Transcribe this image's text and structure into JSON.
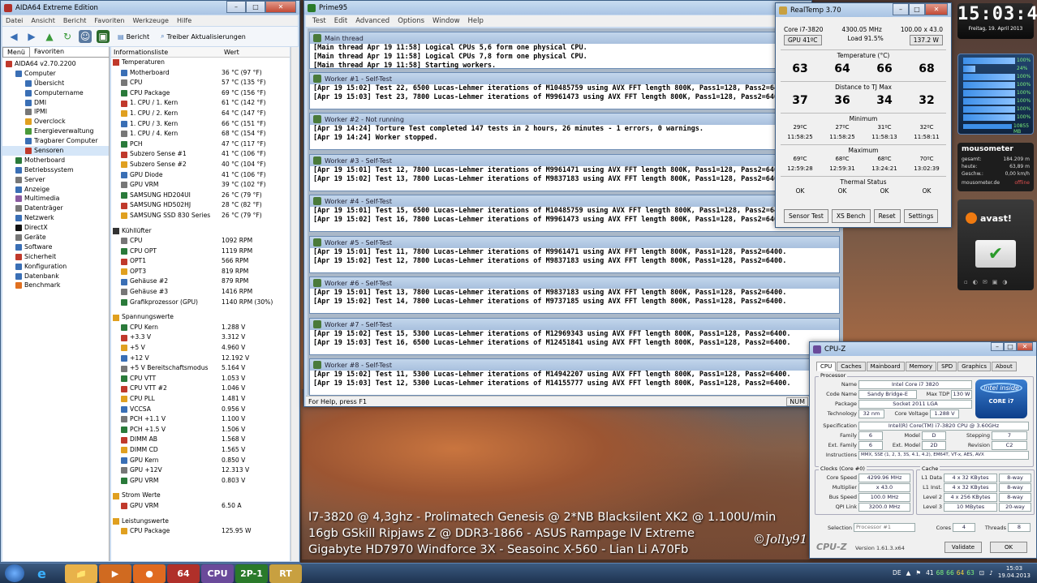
{
  "aida": {
    "title": "AIDA64 Extreme Edition",
    "menu": [
      "Datei",
      "Ansicht",
      "Bericht",
      "Favoriten",
      "Werkzeuge",
      "Hilfe"
    ],
    "toolbar": {
      "report": "Bericht",
      "driver_update": "Treiber Aktualisierungen"
    },
    "tabs": [
      "Menü",
      "Favoriten"
    ],
    "tree": [
      {
        "label": "AIDA64 v2.70.2200",
        "indent": 0,
        "color": "#c0392b"
      },
      {
        "label": "Computer",
        "indent": 1,
        "color": "#3a6fb5"
      },
      {
        "label": "Übersicht",
        "indent": 2,
        "color": "#3a6fb5"
      },
      {
        "label": "Computername",
        "indent": 2,
        "color": "#3a6fb5"
      },
      {
        "label": "DMI",
        "indent": 2,
        "color": "#3a6fb5"
      },
      {
        "label": "IPMI",
        "indent": 2,
        "color": "#777"
      },
      {
        "label": "Overclock",
        "indent": 2,
        "color": "#e0a020"
      },
      {
        "label": "Energieverwaltung",
        "indent": 2,
        "color": "#4a9a3a"
      },
      {
        "label": "Tragbarer Computer",
        "indent": 2,
        "color": "#3a6fb5"
      },
      {
        "label": "Sensoren",
        "indent": 2,
        "color": "#c0392b"
      },
      {
        "label": "Motherboard",
        "indent": 1,
        "color": "#2a7a3a"
      },
      {
        "label": "Betriebssystem",
        "indent": 1,
        "color": "#3a6fb5"
      },
      {
        "label": "Server",
        "indent": 1,
        "color": "#777"
      },
      {
        "label": "Anzeige",
        "indent": 1,
        "color": "#3a6fb5"
      },
      {
        "label": "Multimedia",
        "indent": 1,
        "color": "#8a5aa0"
      },
      {
        "label": "Datenträger",
        "indent": 1,
        "color": "#777"
      },
      {
        "label": "Netzwerk",
        "indent": 1,
        "color": "#3a6fb5"
      },
      {
        "label": "DirectX",
        "indent": 1,
        "color": "#111"
      },
      {
        "label": "Geräte",
        "indent": 1,
        "color": "#777"
      },
      {
        "label": "Software",
        "indent": 1,
        "color": "#3a6fb5"
      },
      {
        "label": "Sicherheit",
        "indent": 1,
        "color": "#c0392b"
      },
      {
        "label": "Konfiguration",
        "indent": 1,
        "color": "#3a6fb5"
      },
      {
        "label": "Datenbank",
        "indent": 1,
        "color": "#3a6fb5"
      },
      {
        "label": "Benchmark",
        "indent": 1,
        "color": "#e07020"
      }
    ],
    "columns": [
      "Informationsliste",
      "Wert"
    ],
    "groups": [
      {
        "title": "Temperaturen",
        "icon": "thermometer-icon",
        "rows": [
          [
            "Motherboard",
            "36 °C  (97 °F)"
          ],
          [
            "CPU",
            "57 °C  (135 °F)"
          ],
          [
            "CPU Package",
            "69 °C  (156 °F)"
          ],
          [
            "1. CPU / 1. Kern",
            "61 °C  (142 °F)"
          ],
          [
            "1. CPU / 2. Kern",
            "64 °C  (147 °F)"
          ],
          [
            "1. CPU / 3. Kern",
            "66 °C  (151 °F)"
          ],
          [
            "1. CPU / 4. Kern",
            "68 °C  (154 °F)"
          ],
          [
            "PCH",
            "47 °C  (117 °F)"
          ],
          [
            "Subzero Sense #1",
            "41 °C  (106 °F)"
          ],
          [
            "Subzero Sense #2",
            "40 °C  (104 °F)"
          ],
          [
            "GPU Diode",
            "41 °C  (106 °F)"
          ],
          [
            "GPU VRM",
            "39 °C  (102 °F)"
          ],
          [
            "SAMSUNG HD204UI",
            "26 °C  (79 °F)"
          ],
          [
            "SAMSUNG HD502HJ",
            "28 °C  (82 °F)"
          ],
          [
            "SAMSUNG SSD 830 Series",
            "26 °C  (79 °F)"
          ]
        ]
      },
      {
        "title": "Kühllüfter",
        "icon": "fan-icon",
        "rows": [
          [
            "CPU",
            "1092 RPM"
          ],
          [
            "CPU OPT",
            "1119 RPM"
          ],
          [
            "OPT1",
            "566 RPM"
          ],
          [
            "OPT3",
            "819 RPM"
          ],
          [
            "Gehäuse #2",
            "879 RPM"
          ],
          [
            "Gehäuse #3",
            "1416 RPM"
          ],
          [
            "Grafikprozessor (GPU)",
            "1140 RPM  (30%)"
          ]
        ]
      },
      {
        "title": "Spannungswerte",
        "icon": "warning-icon",
        "rows": [
          [
            "CPU Kern",
            "1.288 V"
          ],
          [
            "+3.3 V",
            "3.312 V"
          ],
          [
            "+5 V",
            "4.960 V"
          ],
          [
            "+12 V",
            "12.192 V"
          ],
          [
            "+5 V Bereitschaftsmodus",
            "5.164 V"
          ],
          [
            "CPU VTT",
            "1.053 V"
          ],
          [
            "CPU VTT #2",
            "1.046 V"
          ],
          [
            "CPU PLL",
            "1.481 V"
          ],
          [
            "VCCSA",
            "0.956 V"
          ],
          [
            "PCH +1.1 V",
            "1.100 V"
          ],
          [
            "PCH +1.5 V",
            "1.506 V"
          ],
          [
            "DIMM AB",
            "1.568 V"
          ],
          [
            "DIMM CD",
            "1.565 V"
          ],
          [
            "GPU Kern",
            "0.850 V"
          ],
          [
            "GPU +12V",
            "12.313 V"
          ],
          [
            "GPU VRM",
            "0.803 V"
          ]
        ]
      },
      {
        "title": "Strom Werte",
        "icon": "warning-icon",
        "rows": [
          [
            "GPU VRM",
            "6.50 A"
          ]
        ]
      },
      {
        "title": "Leistungswerte",
        "icon": "warning-icon",
        "rows": [
          [
            "CPU Package",
            "125.95 W"
          ]
        ]
      }
    ]
  },
  "prime": {
    "title": "Prime95",
    "menu": [
      "Test",
      "Edit",
      "Advanced",
      "Options",
      "Window",
      "Help"
    ],
    "status_left": "For Help, press F1",
    "status_right": "NUM",
    "windows": [
      {
        "title": "Main thread",
        "lines": [
          "[Main thread Apr 19 11:58] Logical CPUs 5,6 form one physical CPU.",
          "[Main thread Apr 19 11:58] Logical CPUs 7,8 form one physical CPU.",
          "[Main thread Apr 19 11:58] Starting workers."
        ]
      },
      {
        "title": "Worker #1 - Self-Test",
        "lines": [
          "[Apr 19 15:02] Test 22, 6500 Lucas-Lehmer iterations of M10485759 using AVX FFT length 800K, Pass1=128, Pass2=6400.",
          "[Apr 19 15:03] Test 23, 7800 Lucas-Lehmer iterations of M9961473 using AVX FFT length 800K, Pass1=128, Pass2=6400."
        ]
      },
      {
        "title": "Worker #2 - Not running",
        "lines": [
          "[Apr 19 14:24] Torture Test completed 147 tests in 2 hours, 26 minutes - 1 errors, 0 warnings.",
          "[Apr 19 14:24] Worker stopped."
        ]
      },
      {
        "title": "Worker #3 - Self-Test",
        "lines": [
          "[Apr 19 15:01] Test 12, 7800 Lucas-Lehmer iterations of M9961471 using AVX FFT length 800K, Pass1=128, Pass2=6400.",
          "[Apr 19 15:02] Test 13, 7800 Lucas-Lehmer iterations of M9837183 using AVX FFT length 800K, Pass1=128, Pass2=6400."
        ]
      },
      {
        "title": "Worker #4 - Self-Test",
        "lines": [
          "[Apr 19 15:01] Test 15, 6500 Lucas-Lehmer iterations of M10485759 using AVX FFT length 800K, Pass1=128, Pass2=6400.",
          "[Apr 19 15:02] Test 16, 7800 Lucas-Lehmer iterations of M9961473 using AVX FFT length 800K, Pass1=128, Pass2=6400."
        ]
      },
      {
        "title": "Worker #5 - Self-Test",
        "lines": [
          "[Apr 19 15:01] Test 11, 7800 Lucas-Lehmer iterations of M9961471 using AVX FFT length 800K, Pass1=128, Pass2=6400.",
          "[Apr 19 15:02] Test 12, 7800 Lucas-Lehmer iterations of M9837183 using AVX FFT length 800K, Pass1=128, Pass2=6400."
        ]
      },
      {
        "title": "Worker #6 - Self-Test",
        "lines": [
          "[Apr 19 15:01] Test 13, 7800 Lucas-Lehmer iterations of M9837183 using AVX FFT length 800K, Pass1=128, Pass2=6400.",
          "[Apr 19 15:02] Test 14, 7800 Lucas-Lehmer iterations of M9737185 using AVX FFT length 800K, Pass1=128, Pass2=6400."
        ]
      },
      {
        "title": "Worker #7 - Self-Test",
        "lines": [
          "[Apr 19 15:02] Test 15, 5300 Lucas-Lehmer iterations of M12969343 using AVX FFT length 800K, Pass1=128, Pass2=6400.",
          "[Apr 19 15:03] Test 16, 6500 Lucas-Lehmer iterations of M12451841 using AVX FFT length 800K, Pass1=128, Pass2=6400."
        ]
      },
      {
        "title": "Worker #8 - Self-Test",
        "lines": [
          "[Apr 19 15:02] Test 11, 5300 Lucas-Lehmer iterations of M14942207 using AVX FFT length 800K, Pass1=128, Pass2=6400.",
          "[Apr 19 15:03] Test 12, 5300 Lucas-Lehmer iterations of M14155777 using AVX FFT length 800K, Pass1=128, Pass2=6400."
        ]
      }
    ]
  },
  "realtemp": {
    "title": "RealTemp 3.70",
    "cpu": "Core i7-3820",
    "mhz": "4300.05 MHz",
    "multi": "100.00 x 43.0",
    "gpu_btn": "GPU  41ºC",
    "load": "Load  91.5%",
    "watts": "137.2 W",
    "temp_label": "Temperature (°C)",
    "temps": [
      "63",
      "64",
      "66",
      "68"
    ],
    "dist_label": "Distance to TJ Max",
    "dist": [
      "37",
      "36",
      "34",
      "32"
    ],
    "min_label": "Minimum",
    "min_temps": [
      "29ºC",
      "27ºC",
      "31ºC",
      "32ºC"
    ],
    "min_times": [
      "11:58:25",
      "11:58:25",
      "11:58:13",
      "11:58:11"
    ],
    "max_label": "Maximum",
    "max_temps": [
      "69ºC",
      "68ºC",
      "68ºC",
      "70ºC"
    ],
    "max_times": [
      "12:59:28",
      "12:59:31",
      "13:24:21",
      "13:02:39"
    ],
    "thermal_label": "Thermal Status",
    "thermal": [
      "OK",
      "OK",
      "OK",
      "OK"
    ],
    "buttons": [
      "Sensor Test",
      "XS Bench",
      "Reset",
      "Settings"
    ]
  },
  "clock": {
    "time": "15:03:48",
    "date": "Freitag, 19. April 2013"
  },
  "cpu_gadget": {
    "rows": [
      "100%",
      "24%",
      "100%",
      "100%",
      "100%",
      "100%",
      "100%",
      "100%"
    ],
    "memory": "10855 MB"
  },
  "mousometer": {
    "title": "mousometer",
    "rows": [
      [
        "gesamt:",
        "184.209 m"
      ],
      [
        "heute:",
        "63,89 m"
      ],
      [
        "Geschw.:",
        "0,00 km/h"
      ]
    ],
    "footer": "mousometer.de",
    "footer_status": "offline"
  },
  "avast": {
    "logo": "avast!"
  },
  "cpuz": {
    "title": "CPU-Z",
    "tabs": [
      "CPU",
      "Caches",
      "Mainboard",
      "Memory",
      "SPD",
      "Graphics",
      "About"
    ],
    "processor_label": "Processor",
    "name_label": "Name",
    "name": "Intel Core i7 3820",
    "codename_label": "Code Name",
    "codename": "Sandy Bridge-E",
    "maxtdp_label": "Max TDP",
    "maxtdp": "130 W",
    "package_label": "Package",
    "package": "Socket 2011 LGA",
    "tech_label": "Technology",
    "tech": "32 nm",
    "voltage_label": "Core Voltage",
    "voltage": "1.288 V",
    "spec_label": "Specification",
    "spec": "Intel(R) Core(TM) i7-3820 CPU @ 3.60GHz",
    "family_label": "Family",
    "family": "6",
    "model_label": "Model",
    "model": "D",
    "stepping_label": "Stepping",
    "stepping": "7",
    "extfamily_label": "Ext. Family",
    "extfamily": "6",
    "extmodel_label": "Ext. Model",
    "extmodel": "2D",
    "revision_label": "Revision",
    "revision": "C2",
    "instr_label": "Instructions",
    "instr": "MMX, SSE (1, 2, 3, 3S, 4.1, 4.2), EM64T, VT-x, AES, AVX",
    "clocks_label": "Clocks (Core #0)",
    "corespeed_label": "Core Speed",
    "corespeed": "4299.96 MHz",
    "multiplier_label": "Multiplier",
    "multiplier": "x 43.0",
    "busspeed_label": "Bus Speed",
    "busspeed": "100.0 MHz",
    "qpi_label": "QPI Link",
    "qpi": "3200.0 MHz",
    "cache_label": "Cache",
    "l1d_label": "L1 Data",
    "l1d": "4 x 32 KBytes",
    "l1d_way": "8-way",
    "l1i_label": "L1 Inst.",
    "l1i": "4 x 32 KBytes",
    "l1i_way": "8-way",
    "l2_label": "Level 2",
    "l2": "4 x 256 KBytes",
    "l2_way": "8-way",
    "l3_label": "Level 3",
    "l3": "10 MBytes",
    "l3_way": "20-way",
    "selection_label": "Selection",
    "selection": "Processor #1",
    "cores_label": "Cores",
    "cores": "4",
    "threads_label": "Threads",
    "threads": "8",
    "brand": "CPU-Z",
    "version": "Version 1.61.3.x64",
    "validate": "Validate",
    "ok": "OK",
    "intel_inside": "intel inside",
    "intel_core": "CORE i7"
  },
  "wallpaper": {
    "lines": [
      "I7-3820 @ 4,3ghz - Prolimatech Genesis @ 2*NB Blacksilent XK2 @ 1.100U/min",
      "16gb GSkill Ripjaws Z @ DDR3-1866 - ASUS Rampage IV Extreme",
      "Gigabyte HD7970 Windforce 3X - Seasoinc X-560 - Lian Li A70Fb"
    ],
    "signature": "©Jolly91"
  },
  "taskbar": {
    "apps": [
      {
        "name": "explorer",
        "color": "#e8b24a",
        "glyph": "📁"
      },
      {
        "name": "media",
        "color": "#d06a20",
        "glyph": "▶"
      },
      {
        "name": "firefox",
        "color": "#e06a20",
        "glyph": "●"
      },
      {
        "name": "aida64",
        "color": "#b0302a",
        "glyph": "64"
      },
      {
        "name": "cpuz",
        "color": "#6a4a9a",
        "glyph": "CPU"
      },
      {
        "name": "prime95",
        "color": "#2a7a2a",
        "glyph": "2P-1"
      },
      {
        "name": "realtemp",
        "color": "#c8a040",
        "glyph": "RT"
      }
    ],
    "lang": "DE",
    "tray_temps": [
      "41",
      "68",
      "66",
      "64",
      "63"
    ],
    "time": "15:03",
    "date": "19.04.2013"
  }
}
